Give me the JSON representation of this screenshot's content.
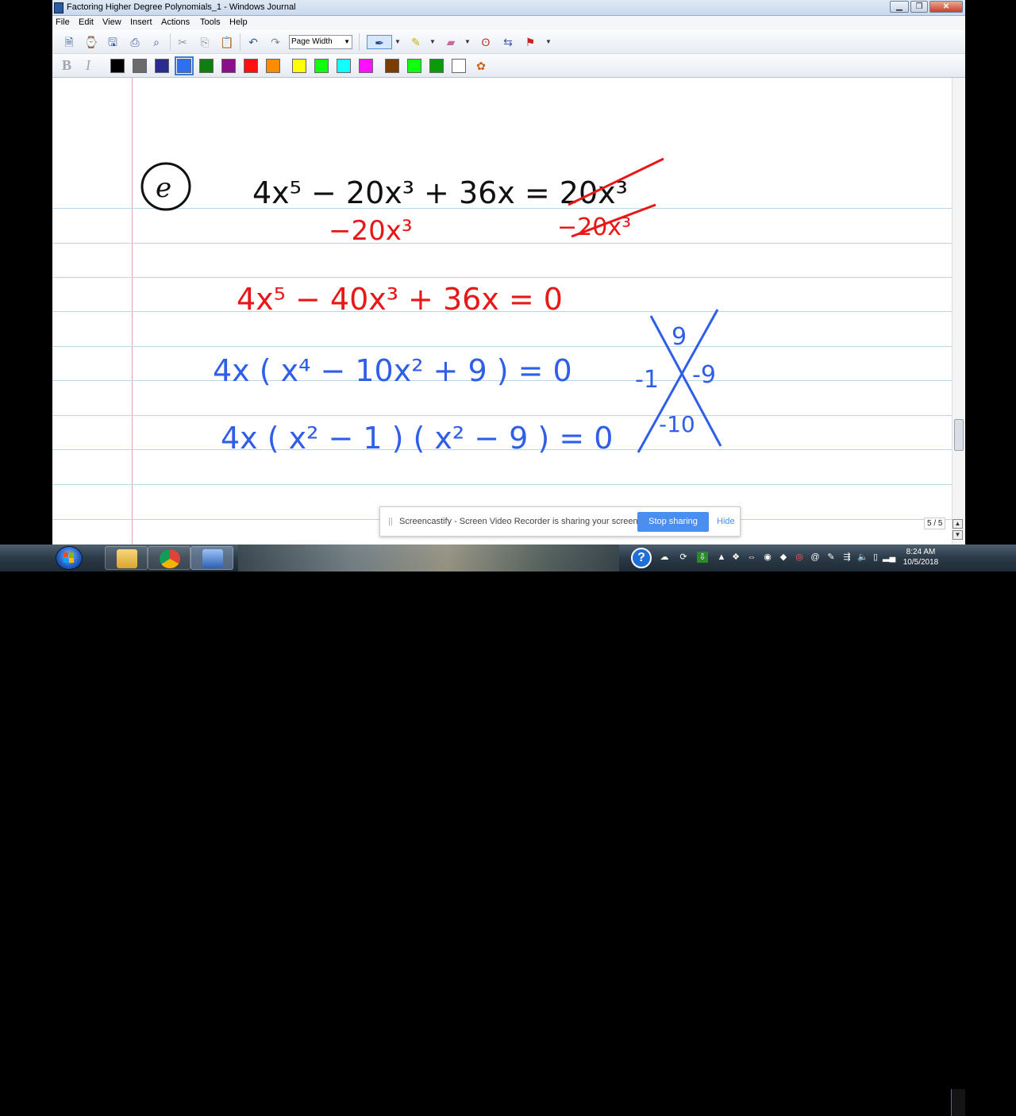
{
  "window": {
    "title": "Factoring Higher Degree Polynomials_1 - Windows Journal",
    "min_label": "▁",
    "max_label": "❐",
    "close_label": "✕"
  },
  "menu": [
    "File",
    "Edit",
    "View",
    "Insert",
    "Actions",
    "Tools",
    "Help"
  ],
  "toolbar": {
    "zoom_value": "Page Width",
    "bold_label": "B",
    "italic_label": "I",
    "colors": [
      "#000000",
      "#6b6b6b",
      "#2b2b8f",
      "#2f6ff0",
      "#0f7d0f",
      "#8b0f8b",
      "#ff1010",
      "#ff8c00",
      "#ffff00",
      "#10ff10",
      "#10ffff",
      "#ff10ff",
      "#7a3d00",
      "#10ff10",
      "#0a9a0a",
      "#ffffff"
    ],
    "selected_color": "#2f6ff0"
  },
  "ink": {
    "problem_label": "e",
    "line1": "4x⁵ − 20x³ + 36x = 20x³",
    "sub_left": "−20x³",
    "sub_right": "−20x³",
    "line2": "4x⁵ − 40x³ + 36x = 0",
    "line3": "4x ( x⁴ − 10x² + 9 ) = 0",
    "line4": "4x ( x² − 1 ) ( x² − 9 ) = 0",
    "x_top": "9",
    "x_left": "-1",
    "x_right": "-9",
    "x_bottom": "-10",
    "red": "#e81818",
    "blue": "#2f5ee8",
    "black": "#111111"
  },
  "page_indicator": "5 / 5",
  "share": {
    "grip": "||",
    "message": "Screencastify - Screen Video Recorder is sharing your screen.",
    "stop_label": "Stop sharing",
    "hide_label": "Hide"
  },
  "taskbar": {
    "help_label": "?",
    "time": "8:24 AM",
    "date": "10/5/2018"
  }
}
